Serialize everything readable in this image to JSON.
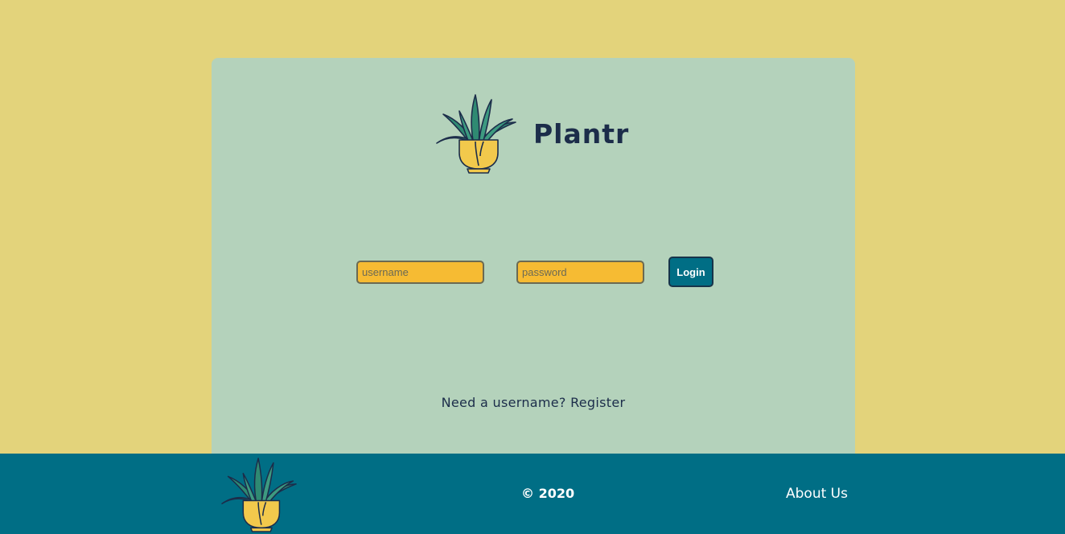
{
  "brand": {
    "logo_icon": "potted-plant-icon",
    "title": "Plantr"
  },
  "login": {
    "username_placeholder": "username",
    "username_value": "",
    "password_placeholder": "password",
    "password_value": "",
    "button_label": "Login"
  },
  "register": {
    "prompt": "Need a username?",
    "link_label": "Register"
  },
  "footer": {
    "logo_icon": "potted-plant-icon",
    "copyright": "© 2020",
    "about_label": "About Us"
  },
  "colors": {
    "page_background": "#e3d37b",
    "card_background": "#b4d2bb",
    "input_background": "#f6bb33",
    "accent": "#006e85",
    "text": "#1c2d4a",
    "leaf": "#2f8a72",
    "pot": "#f2c94c"
  }
}
